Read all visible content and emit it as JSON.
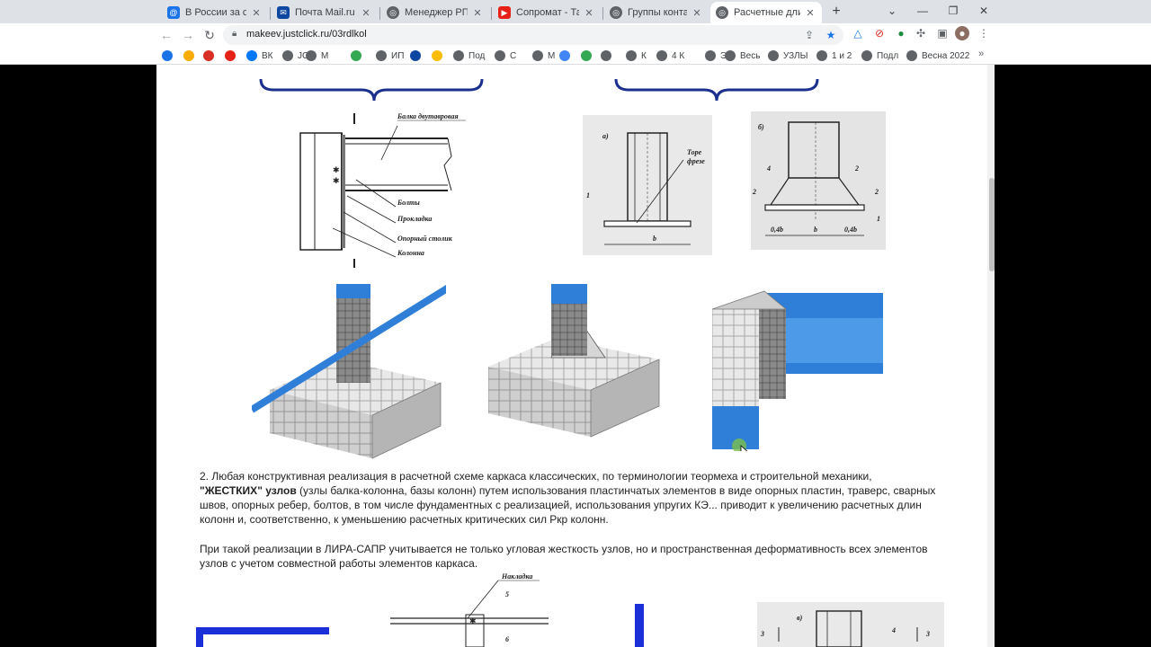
{
  "tabs": [
    {
      "title": "В России за сутки",
      "active": false
    },
    {
      "title": "Почта Mail.ru",
      "active": false
    },
    {
      "title": "Менеджер РПД",
      "active": false
    },
    {
      "title": "Сопромат - Тайны",
      "active": false
    },
    {
      "title": "Группы контактов",
      "active": false
    },
    {
      "title": "Расчетные длины",
      "active": true
    }
  ],
  "address": {
    "url": "makeev.justclick.ru/03rdlkol"
  },
  "bookmarks": [
    {
      "label": ""
    },
    {
      "label": ""
    },
    {
      "label": ""
    },
    {
      "label": ""
    },
    {
      "label": "ВК"
    },
    {
      "label": "JC"
    },
    {
      "label": "М"
    },
    {
      "label": ""
    },
    {
      "label": "ИП"
    },
    {
      "label": ""
    },
    {
      "label": ""
    },
    {
      "label": "Под"
    },
    {
      "label": "С"
    },
    {
      "label": "М"
    },
    {
      "label": ""
    },
    {
      "label": ""
    },
    {
      "label": ""
    },
    {
      "label": "К"
    },
    {
      "label": "4 К"
    },
    {
      "label": "Э"
    },
    {
      "label": "Весь"
    },
    {
      "label": "УЗЛЫ"
    },
    {
      "label": "1 и 2"
    },
    {
      "label": "Подл"
    },
    {
      "label": "Весна 2022"
    }
  ],
  "drawing_labels": {
    "beam": "Балка двутавровая",
    "bolts": "Болты",
    "shim": "Прокладка",
    "support": "Опорный столик",
    "column": "Колонна",
    "a": "а)",
    "face": "Торе",
    "milled": "фрезе",
    "b": "б)",
    "one": "1",
    "two": "2",
    "four": "4",
    "dim_b": "b",
    "dim_04b": "0,4b",
    "nakladka": "Накладка",
    "five": "5",
    "six": "6",
    "v": "в)",
    "three": "3"
  },
  "paragraph1": {
    "pre": "2. Любая конструктивная реализация в расчетной схеме каркаса классических, по терминологии теормеха и строительной механики,",
    "bold": "\"ЖЕСТКИХ\" узлов",
    "post": "  (узлы балка-колонна, базы колонн) путем использования пластинчатых элементов в виде опорных пластин, траверс, сварных швов, опорных ребер, болтов, в том числе фундаментных с реализацией, использования упругих КЭ... приводит к увеличению расчетных длин колонн и, соответственно, к уменьшению расчетных критических сил Ркр колонн."
  },
  "paragraph2": "При такой реализации в ЛИРА-САПР учитывается не только угловая жесткость узлов, но и пространственная деформативность всех элементов узлов с учетом совместной работы элементов каркаса.",
  "colors": {
    "accent_blue": "#2f7fd9",
    "brace_navy": "#1b2f8f",
    "mesh_grey": "#c8c8c8"
  }
}
